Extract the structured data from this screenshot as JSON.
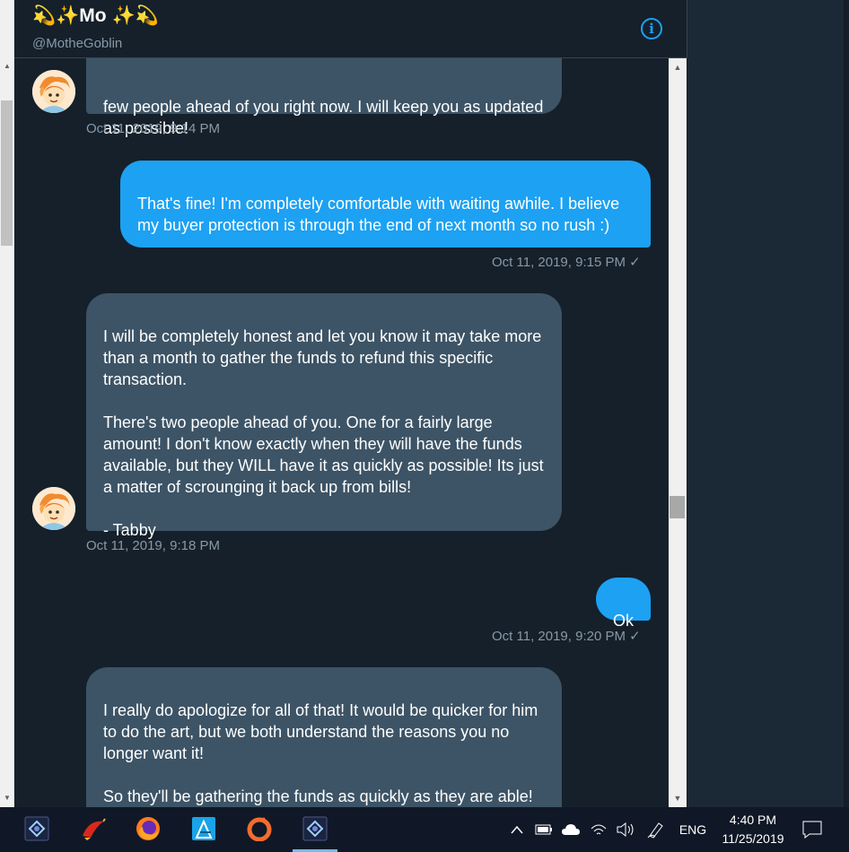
{
  "header": {
    "display_name": "💫✨Mo ✨💫",
    "handle": "@MotheGoblin",
    "info_icon": "info-icon"
  },
  "messages": [
    {
      "type": "received",
      "text": "few people ahead of you right now. I will keep you as updated as possible!",
      "timestamp": "Oct 11, 2019, 9:14 PM"
    },
    {
      "type": "sent",
      "text": "That's fine! I'm completely comfortable with waiting awhile. I believe my buyer protection is through the end of next month so no rush :)",
      "timestamp": "Oct 11, 2019, 9:15 PM"
    },
    {
      "type": "received",
      "text": "I will be completely honest and let you know it may take more than a month to gather the funds to refund this specific transaction.\n\nThere's two people ahead of you. One for a fairly large amount! I don't know exactly when they will have the funds available, but they WILL have it as quickly as possible! Its just a matter of scrounging it back up from bills!\n\n - Tabby",
      "timestamp": "Oct 11, 2019, 9:18 PM"
    },
    {
      "type": "sent",
      "text": "Ok",
      "timestamp": "Oct 11, 2019, 9:20 PM"
    },
    {
      "type": "received",
      "text": "I really do apologize for all of that! It would be quicker for him to do the art, but we both understand the reasons you no longer want it!\n\nSo they'll be gathering the funds as quickly as they are able! If you have any questions, please don't hesitate to",
      "timestamp": ""
    }
  ],
  "read_mark": "✓",
  "taskbar": {
    "apps": [
      "affinity-photo-icon",
      "paint-brush-app-icon",
      "firefox-icon",
      "affinity-designer-icon",
      "origin-icon",
      "affinity-photo-icon"
    ],
    "tray": {
      "language": "ENG",
      "time": "4:40 PM",
      "date": "11/25/2019"
    }
  },
  "colors": {
    "background": "#15202b",
    "received_bubble": "#3d5466",
    "sent_bubble": "#1da1f2",
    "timestamp": "#8899a6",
    "taskbar": "#101827"
  }
}
